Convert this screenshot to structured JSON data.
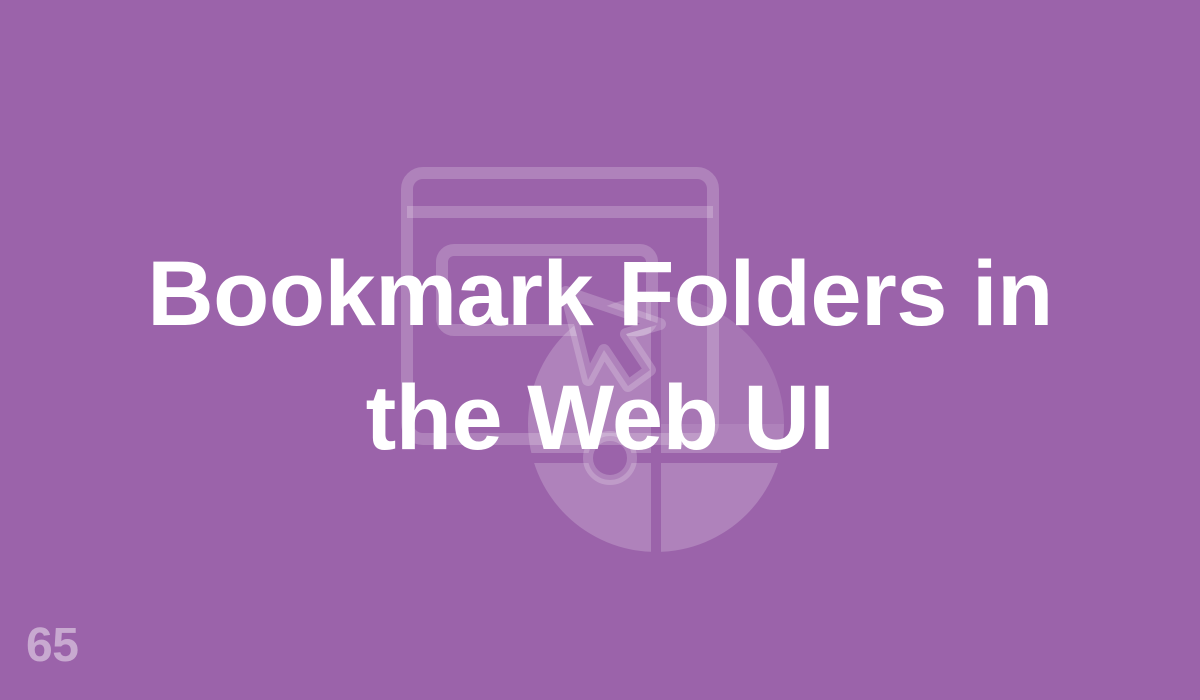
{
  "colors": {
    "background": "#9b63aa",
    "title_text": "#ffffff",
    "episode_number_text": "rgba(255,255,255,0.45)",
    "illustration": "rgba(255,255,255,0.2)"
  },
  "illustration": {
    "icons": [
      "browser-window-icon",
      "cursor-arrow-icon",
      "pie-chart-icon"
    ]
  },
  "title": {
    "line1": "Bookmark Folders in",
    "line2": "the Web UI"
  },
  "episode_number": "65"
}
